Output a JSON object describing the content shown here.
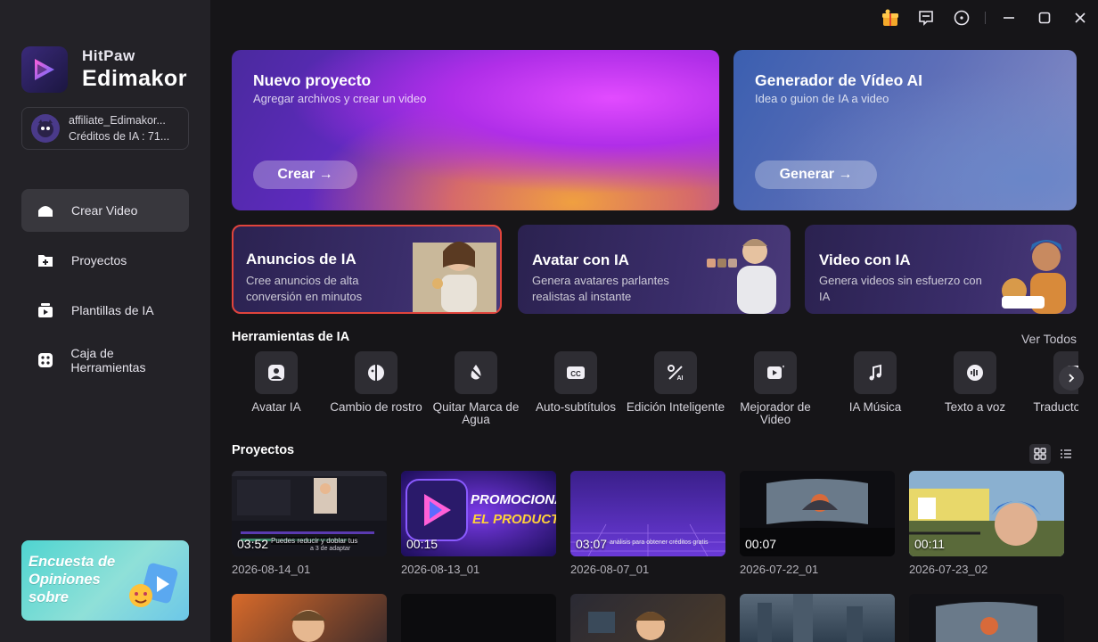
{
  "brand": {
    "line1": "HitPaw",
    "line2": "Edimakor"
  },
  "account": {
    "name": "affiliate_Edimakor...",
    "credits": "Créditos de IA : 71..."
  },
  "nav": [
    {
      "label": "Crear Video",
      "icon": "home-icon",
      "active": true
    },
    {
      "label": "Proyectos",
      "icon": "folder-plus-icon"
    },
    {
      "label": "Plantillas de IA",
      "icon": "template-icon"
    },
    {
      "label": "Caja de Herramientas",
      "icon": "toolbox-icon"
    }
  ],
  "survey": {
    "text": "Encuesta de Opiniones sobre"
  },
  "hero": [
    {
      "title": "Nuevo proyecto",
      "subtitle": "Agregar archivos y crear un video",
      "button": "Crear →"
    },
    {
      "title": "Generador de Vídeo AI",
      "subtitle": "Idea o guion de IA a video",
      "button": "Generar →"
    }
  ],
  "features": [
    {
      "title": "Anuncios de IA",
      "subtitle": "Cree anuncios de alta conversión en minutos"
    },
    {
      "title": "Avatar con IA",
      "subtitle": "Genera avatares parlantes realistas al instante"
    },
    {
      "title": "Video con IA",
      "subtitle": "Genera videos sin esfuerzo con IA"
    }
  ],
  "tools_section": {
    "title": "Herramientas de IA",
    "see_all": "Ver Todos"
  },
  "tools": [
    {
      "label": "Avatar IA",
      "icon": "avatar-icon"
    },
    {
      "label": "Cambio de rostro",
      "icon": "face-swap-icon"
    },
    {
      "label": "Quitar Marca de Agua",
      "icon": "remove-watermark-icon"
    },
    {
      "label": "Auto-subtítulos",
      "icon": "cc-icon"
    },
    {
      "label": "Edición Inteligente",
      "icon": "smart-edit-icon"
    },
    {
      "label": "Mejorador de Video",
      "icon": "video-enhance-icon"
    },
    {
      "label": "IA Música",
      "icon": "music-icon"
    },
    {
      "label": "Texto a voz",
      "icon": "tts-icon"
    },
    {
      "label": "Traductor video",
      "icon": "translate-icon"
    }
  ],
  "projects_section": {
    "title": "Proyectos"
  },
  "projects": [
    {
      "name": "2026-08-14_01",
      "duration": "03:52",
      "caption": "Puedes reducir y doblar tus",
      "caption2": "a 3 de adaptar",
      "accent": "#1a1a24"
    },
    {
      "name": "2026-08-13_01",
      "duration": "00:15",
      "caption": "PROMOCIONAR",
      "caption2": "EL PRODUCTO",
      "accent": "#3a1a8a"
    },
    {
      "name": "2026-08-07_01",
      "duration": "03:07",
      "caption": "análisis para obtener créditos gratis",
      "caption2": "",
      "accent": "#3a1f7a"
    },
    {
      "name": "2026-07-22_01",
      "duration": "00:07",
      "caption": "",
      "caption2": "",
      "accent": "#121216"
    },
    {
      "name": "2026-07-23_02",
      "duration": "00:11",
      "caption": "",
      "caption2": "",
      "accent": "#6a8a4a"
    }
  ]
}
